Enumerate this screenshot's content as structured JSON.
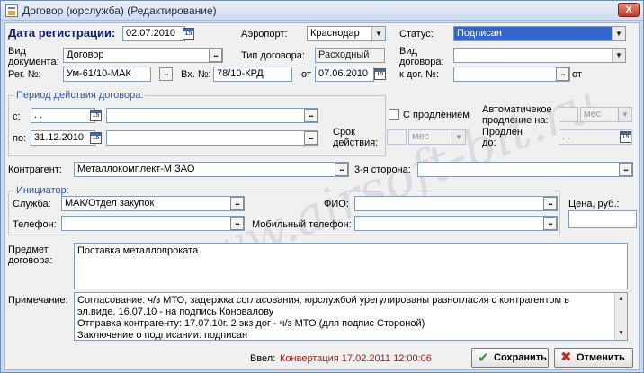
{
  "window": {
    "title": "Договор (юрслужба) (Редактирование)",
    "close": "X"
  },
  "watermark": "www.airsoft-bit.ru",
  "header": {
    "reg_date_label": "Дата регистрации:",
    "reg_date": "02.07.2010",
    "airport_label": "Аэропорт:",
    "airport": "Краснодар",
    "status_label": "Статус:",
    "status": "Подписан",
    "doc_type_label": "Вид документа:",
    "doc_type": "Договор",
    "contract_type_label": "Тип договора:",
    "contract_type": "Расходный",
    "contract_kind_label": "Вид договора:",
    "contract_kind": "",
    "reg_no_label": "Рег. №:",
    "reg_no": "Ум-61/10-МАК",
    "in_no_label": "Вх. №:",
    "in_no": "78/10-КРД",
    "from_label": "от",
    "in_date": "07.06.2010",
    "to_contract_label": "к дог. №:",
    "to_contract": "",
    "to_contract_from": "от"
  },
  "period": {
    "title": "Период действия договора:",
    "from_label": "с:",
    "from_date": " .  .",
    "from_extra": "",
    "to_label": "по:",
    "to_date": "31.12.2010",
    "to_extra": "",
    "extension_label": "С продлением",
    "auto_ext_label": "Автоматичекое продление на:",
    "auto_ext_value": "",
    "auto_ext_unit": "мес",
    "term_label": "Срок действия:",
    "term_value": "",
    "term_unit": "мес",
    "extended_to_label": "Продлен до:",
    "extended_to": " .  ."
  },
  "counterparty": {
    "label": "Контрагент:",
    "value": "Металлокомплект-М ЗАО",
    "third_label": "3-я сторона:",
    "third_value": ""
  },
  "initiator": {
    "title": "Инициатор:",
    "service_label": "Служба:",
    "service": "МАК/Отдел закупок",
    "fio_label": "ФИО:",
    "fio": "",
    "phone_label": "Телефон:",
    "phone": "",
    "mobile_label": "Мобильный телефон:",
    "mobile": "",
    "price_label": "Цена, руб.:",
    "price": ""
  },
  "subject": {
    "label": "Предмет договора:",
    "value": "Поставка металлопроката"
  },
  "note": {
    "label": "Примечание:",
    "lines": [
      "Согласование: ч/з МТО, задержка согласования, юрслужбой урегулированы разногласия с контрагентом в",
      "эл.виде, 16.07.10 - на подпись Коновалову",
      "Отправка контрагенту: 17.07.10г. 2 экз дог - ч/з МТО (для подпис Стороной)",
      "Заключение о подписании: подписан"
    ]
  },
  "footer": {
    "entered_label": "Ввел:",
    "entered_value": "Конвертация 17.02.2011 12:00:06",
    "save_label": "Сохранить",
    "cancel_label": "Отменить"
  },
  "ellipsis": "...",
  "cal_text": "15",
  "colors": {
    "accent": "#3366cc",
    "entered": "#a0201a",
    "save_icon": "#2e9a2e",
    "cancel_icon": "#c0281c"
  }
}
